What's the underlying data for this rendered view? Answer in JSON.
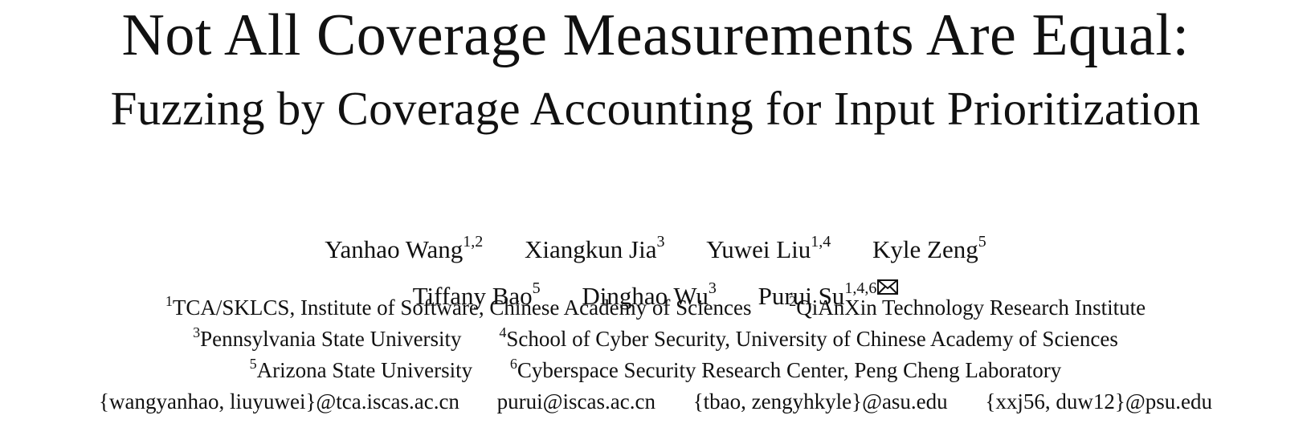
{
  "title": {
    "line1": "Not All Coverage Measurements Are Equal:",
    "line2": "Fuzzing by Coverage Accounting for Input Prioritization"
  },
  "authors": {
    "row1": [
      {
        "name": "Yanhao Wang",
        "sup": "1,2"
      },
      {
        "name": "Xiangkun Jia",
        "sup": "3"
      },
      {
        "name": "Yuwei Liu",
        "sup": "1,4"
      },
      {
        "name": "Kyle Zeng",
        "sup": "5"
      }
    ],
    "row2": [
      {
        "name": "Tiffany Bao",
        "sup": "5"
      },
      {
        "name": "Dinghao Wu",
        "sup": "3"
      },
      {
        "name": "Purui Su",
        "sup": "1,4,6",
        "corresponding_icon": "envelope-icon"
      }
    ]
  },
  "affiliations": {
    "row1": [
      {
        "sup": "1",
        "text": "TCA/SKLCS, Institute of Software, Chinese Academy of Sciences"
      },
      {
        "sup": "2",
        "text": "QiAnXin Technology Research Institute"
      }
    ],
    "row2": [
      {
        "sup": "3",
        "text": "Pennsylvania State University"
      },
      {
        "sup": "4",
        "text": "School of Cyber Security, University of Chinese Academy of Sciences"
      }
    ],
    "row3": [
      {
        "sup": "5",
        "text": "Arizona State University"
      },
      {
        "sup": "6",
        "text": "Cyberspace Security Research Center, Peng Cheng Laboratory"
      }
    ]
  },
  "emails": [
    "{wangyanhao, liuyuwei}@tca.iscas.ac.cn",
    "purui@iscas.ac.cn",
    "{tbao, zengyhkyle}@asu.edu",
    "{xxj56, duw12}@psu.edu"
  ]
}
